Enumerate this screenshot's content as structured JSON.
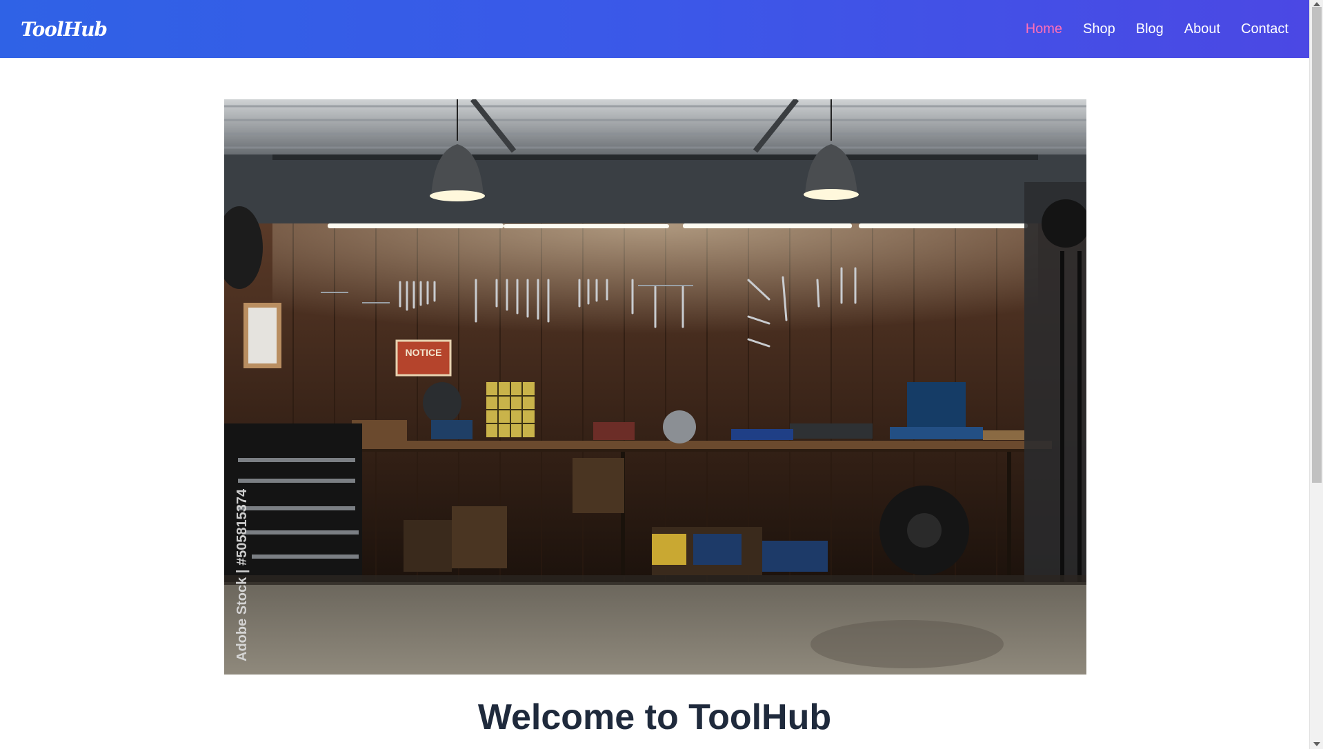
{
  "brand": {
    "logo_text": "ToolHub"
  },
  "nav": {
    "items": [
      {
        "label": "Home",
        "active": true
      },
      {
        "label": "Shop",
        "active": false
      },
      {
        "label": "Blog",
        "active": false
      },
      {
        "label": "About",
        "active": false
      },
      {
        "label": "Contact",
        "active": false
      }
    ]
  },
  "hero": {
    "watermark": "Adobe Stock | #505815374",
    "notice_sign": "NOTICE"
  },
  "main": {
    "heading": "Welcome to ToolHub"
  },
  "colors": {
    "header_gradient_start": "#2f62e6",
    "header_gradient_end": "#4b48e4",
    "nav_active": "#ff6fb7",
    "heading": "#1f2a3c"
  }
}
